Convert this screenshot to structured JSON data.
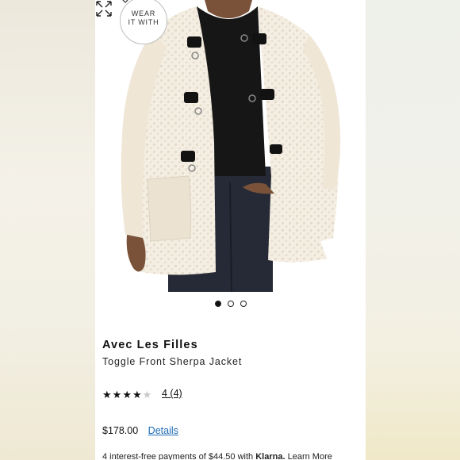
{
  "badge": {
    "line1": "WEAR",
    "line2": "IT WITH"
  },
  "carousel": {
    "count": 3,
    "active_index": 0
  },
  "product": {
    "brand": "Avec Les Filles",
    "name": "Toggle Front Sherpa Jacket",
    "rating": 4,
    "rating_max": 5,
    "rating_text": "4 (4)",
    "price": "$178.00",
    "details_label": "Details"
  },
  "klarna": {
    "prefix": "4 interest-free payments of $44.50 with",
    "brand": "Klarna.",
    "link": "Learn More"
  },
  "colors": {
    "link": "#1f6bb5",
    "jacket": "#f4ede1"
  },
  "icons": {
    "expand": "expand-arrows-icon",
    "chevron": "chevron-down-icon",
    "star": "star-icon"
  }
}
